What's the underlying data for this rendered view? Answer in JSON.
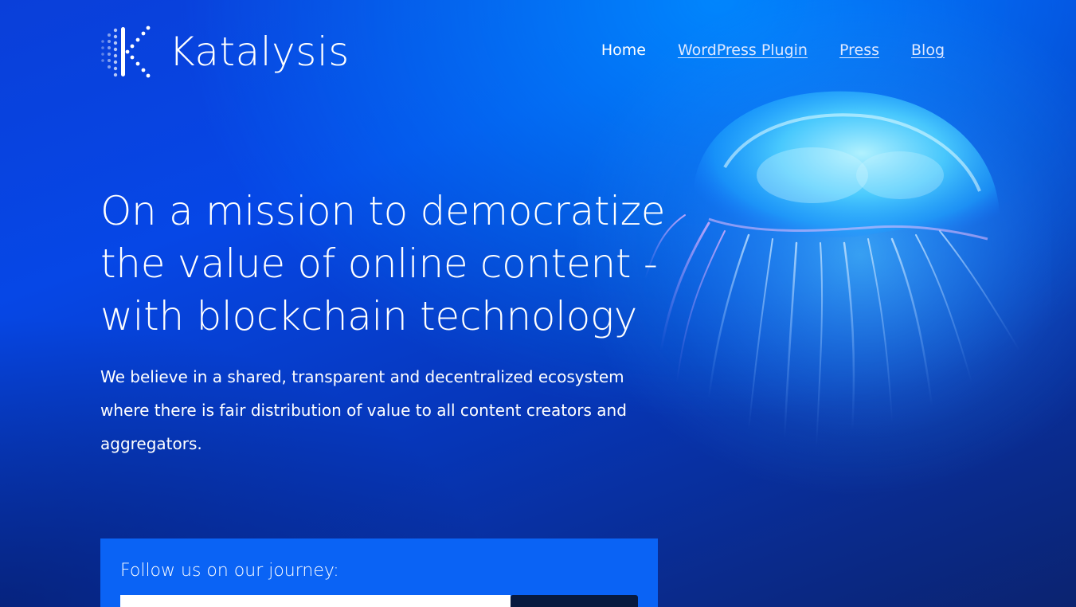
{
  "brand": {
    "name": "Katalysis"
  },
  "nav": {
    "items": [
      {
        "label": "Home",
        "active": true
      },
      {
        "label": "WordPress Plugin",
        "active": false
      },
      {
        "label": "Press",
        "active": false
      },
      {
        "label": "Blog",
        "active": false
      }
    ]
  },
  "hero": {
    "title": "On a mission to democratize the value of online content - with blockchain technology",
    "description": "We believe in a shared, transparent and decentralized ecosystem where there is fair distribution of value to all content creators and aggregators."
  },
  "subscribe": {
    "label": "Follow us on our journey:",
    "input_value": "",
    "button_label": ""
  },
  "colors": {
    "background": "#0647e6",
    "subscribe_box": "#0a63f5",
    "button": "#071a3f",
    "text": "#ffffff"
  },
  "icons": {
    "logo": "katalysis-k-dots-logo-icon",
    "hero_image": "jellyfish-image"
  }
}
